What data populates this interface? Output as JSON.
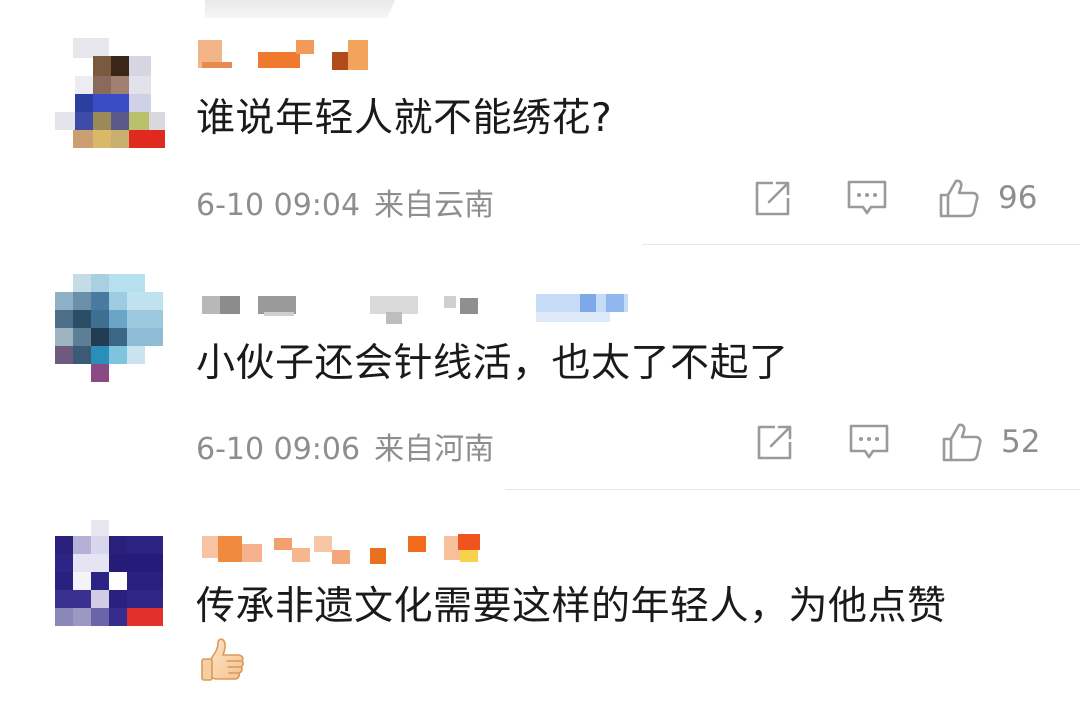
{
  "comments": [
    {
      "username": "",
      "text": "谁说年轻人就不能绣花?",
      "date": "6-10 09:04",
      "location": "来自云南",
      "like_count": "96"
    },
    {
      "username": "",
      "text": "小伙子还会针线活，也太了不起了",
      "date": "6-10 09:06",
      "location": "来自河南",
      "like_count": "52"
    },
    {
      "username": "",
      "text": "传承非遗文化需要这样的年轻人，为他点赞",
      "emoji": "thumbs-up"
    }
  ],
  "icons": {
    "share": "share-icon",
    "comment": "comment-icon",
    "like": "thumbs-up-icon"
  },
  "colors": {
    "text": "#1a1a1a",
    "meta": "#8e8e8e",
    "icon": "#9a9a9a",
    "divider": "#e6e6e6"
  }
}
